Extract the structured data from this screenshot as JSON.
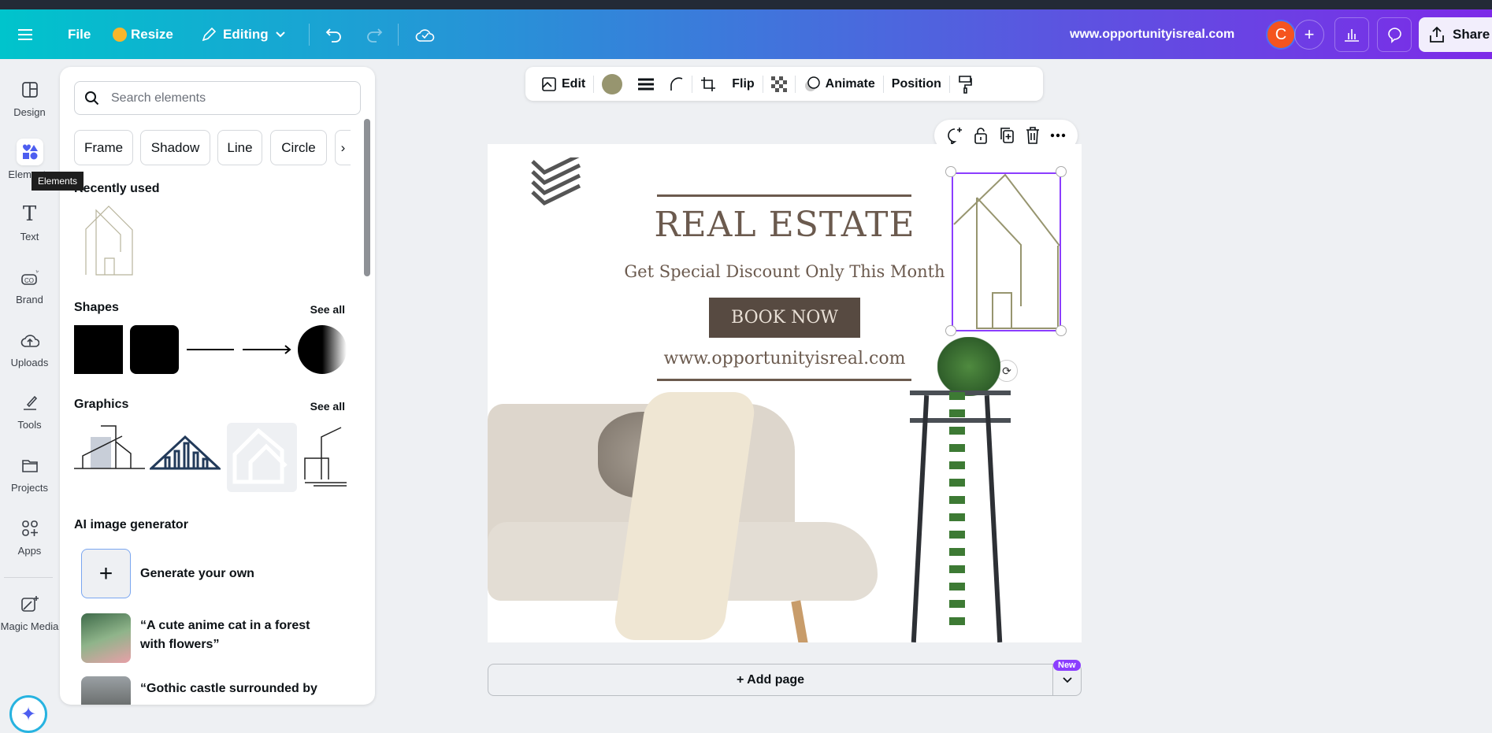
{
  "topbar": {
    "file": "File",
    "resize": "Resize",
    "editing": "Editing",
    "title": "www.opportunityisreal.com",
    "avatar_initial": "C",
    "share": "Share"
  },
  "rail": {
    "items": [
      {
        "label": "Design"
      },
      {
        "label": "Elements"
      },
      {
        "label": "Text"
      },
      {
        "label": "Brand"
      },
      {
        "label": "Uploads"
      },
      {
        "label": "Tools"
      },
      {
        "label": "Projects"
      },
      {
        "label": "Apps"
      },
      {
        "label": "Magic Media"
      }
    ],
    "tooltip": "Elements"
  },
  "panel": {
    "search_placeholder": "Search elements",
    "chips": [
      "Frame",
      "Shadow",
      "Line",
      "Circle"
    ],
    "recently_used": "Recently used",
    "shapes": "Shapes",
    "graphics": "Graphics",
    "see_all": "See all",
    "ai_heading": "AI image generator",
    "ai_items": [
      "Generate your own",
      "“A cute anime cat in a forest with flowers”",
      "“Gothic castle surrounded by"
    ]
  },
  "canvas_toolbar": {
    "edit": "Edit",
    "flip": "Flip",
    "animate": "Animate",
    "position": "Position",
    "color": "#97956f"
  },
  "design": {
    "title": "REAL ESTATE",
    "subtitle": "Get Special Discount Only This Month",
    "button": "BOOK NOW",
    "url": "www.opportunityisreal.com"
  },
  "add_page": "+ Add page",
  "new_badge": "New",
  "colors": {
    "accent": "#8b3dff",
    "brown": "#6b5a4e",
    "button_bg": "#574a41",
    "house": "#97956f"
  }
}
